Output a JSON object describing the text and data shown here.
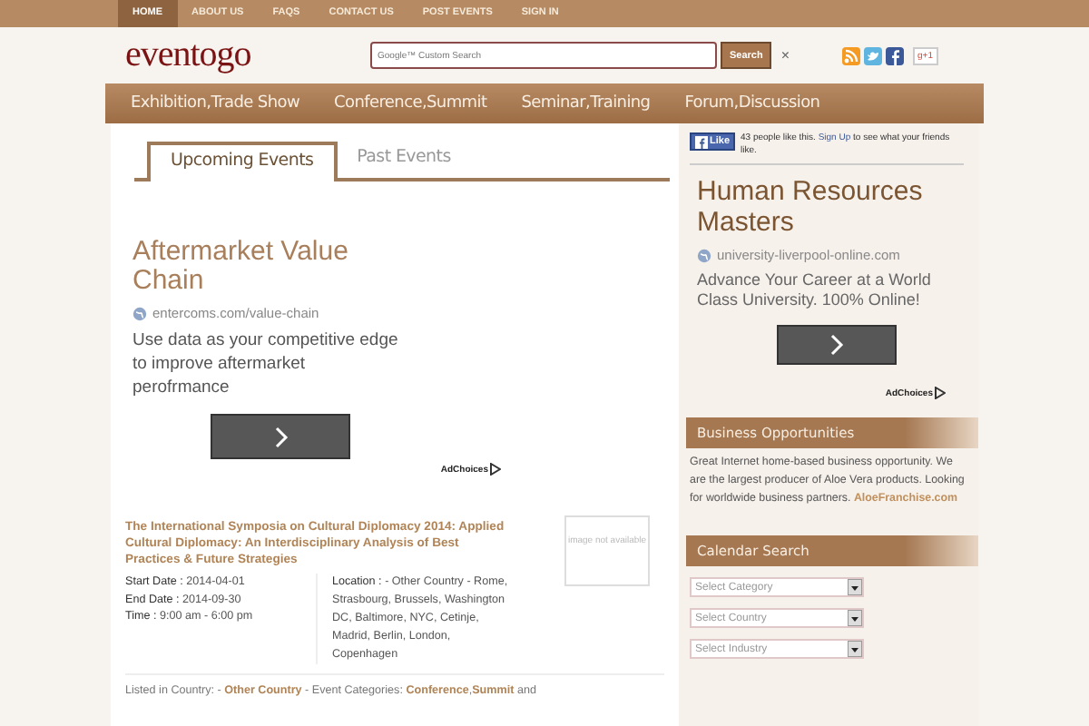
{
  "top_nav": [
    {
      "label": "HOME",
      "selected": true
    },
    {
      "label": "ABOUT US",
      "selected": false
    },
    {
      "label": "FAQS",
      "selected": false
    },
    {
      "label": "CONTACT US",
      "selected": false
    },
    {
      "label": "POST EVENTS",
      "selected": false
    },
    {
      "label": "SIGN IN",
      "selected": false
    }
  ],
  "header": {
    "logo": "eventogo",
    "search": {
      "placeholder": "Google™ Custom Search"
    },
    "search_button": "Search",
    "clear": "×",
    "plus_one": "g+1"
  },
  "categories": [
    "Exhibition,Trade Show",
    "Conference,Summit",
    "Seminar,Training",
    "Forum,Discussion"
  ],
  "tabs": [
    {
      "label": "Upcoming Events",
      "selected": true
    },
    {
      "label": "Past Events",
      "selected": false
    }
  ],
  "ad": {
    "title": "Aftermarket Value Chain",
    "url": "entercoms.com/value-chain",
    "text": "Use data as your competitive edge to improve aftermarket perofrmance",
    "adchoices": "AdChoices"
  },
  "event": {
    "title": "The International Symposia on Cultural Diplomacy 2014: Applied Cultural Diplomacy: An Interdisciplinary Analysis of Best Practices & Future Strategies",
    "details": [
      {
        "label": "Start Date :",
        "value": "2014-04-01"
      },
      {
        "label": "End Date :",
        "value": "2014-09-30"
      },
      {
        "label": "Time :",
        "value": "9:00 am - 6:00 pm"
      }
    ],
    "location_label": "Location :",
    "location": "- Other Country - Rome, Strasbourg, Brussels, Washington DC, Baltimore, NYC, Cetinje, Madrid, Berlin, London, Copenhagen",
    "image_text": "image not available",
    "listing": "Listed in Country: - **Other Country** - Event Categories: **Conference**,**Summit** and"
  },
  "sidebar": {
    "like": {
      "button": "Like",
      "before": "43 people like this.",
      "link": "Sign Up",
      "after": "to see what your friends like."
    },
    "ad": {
      "title": "Human Resources Masters",
      "url": "university-liverpool-online.com",
      "text": "Advance Your Career at a World Class University. 100% Online!",
      "adchoices": "AdChoices"
    },
    "business": {
      "heading": "Business Opportunities",
      "text": "Great Internet home-based business opportunity. We are the largest producer of Aloe Vera products. Looking for worldwide business partners.",
      "link": "AloeFranchise.com"
    },
    "calendar": {
      "heading": "Calendar Search",
      "selects": [
        "Select Category",
        "Select Country",
        "Select Industry"
      ]
    }
  }
}
